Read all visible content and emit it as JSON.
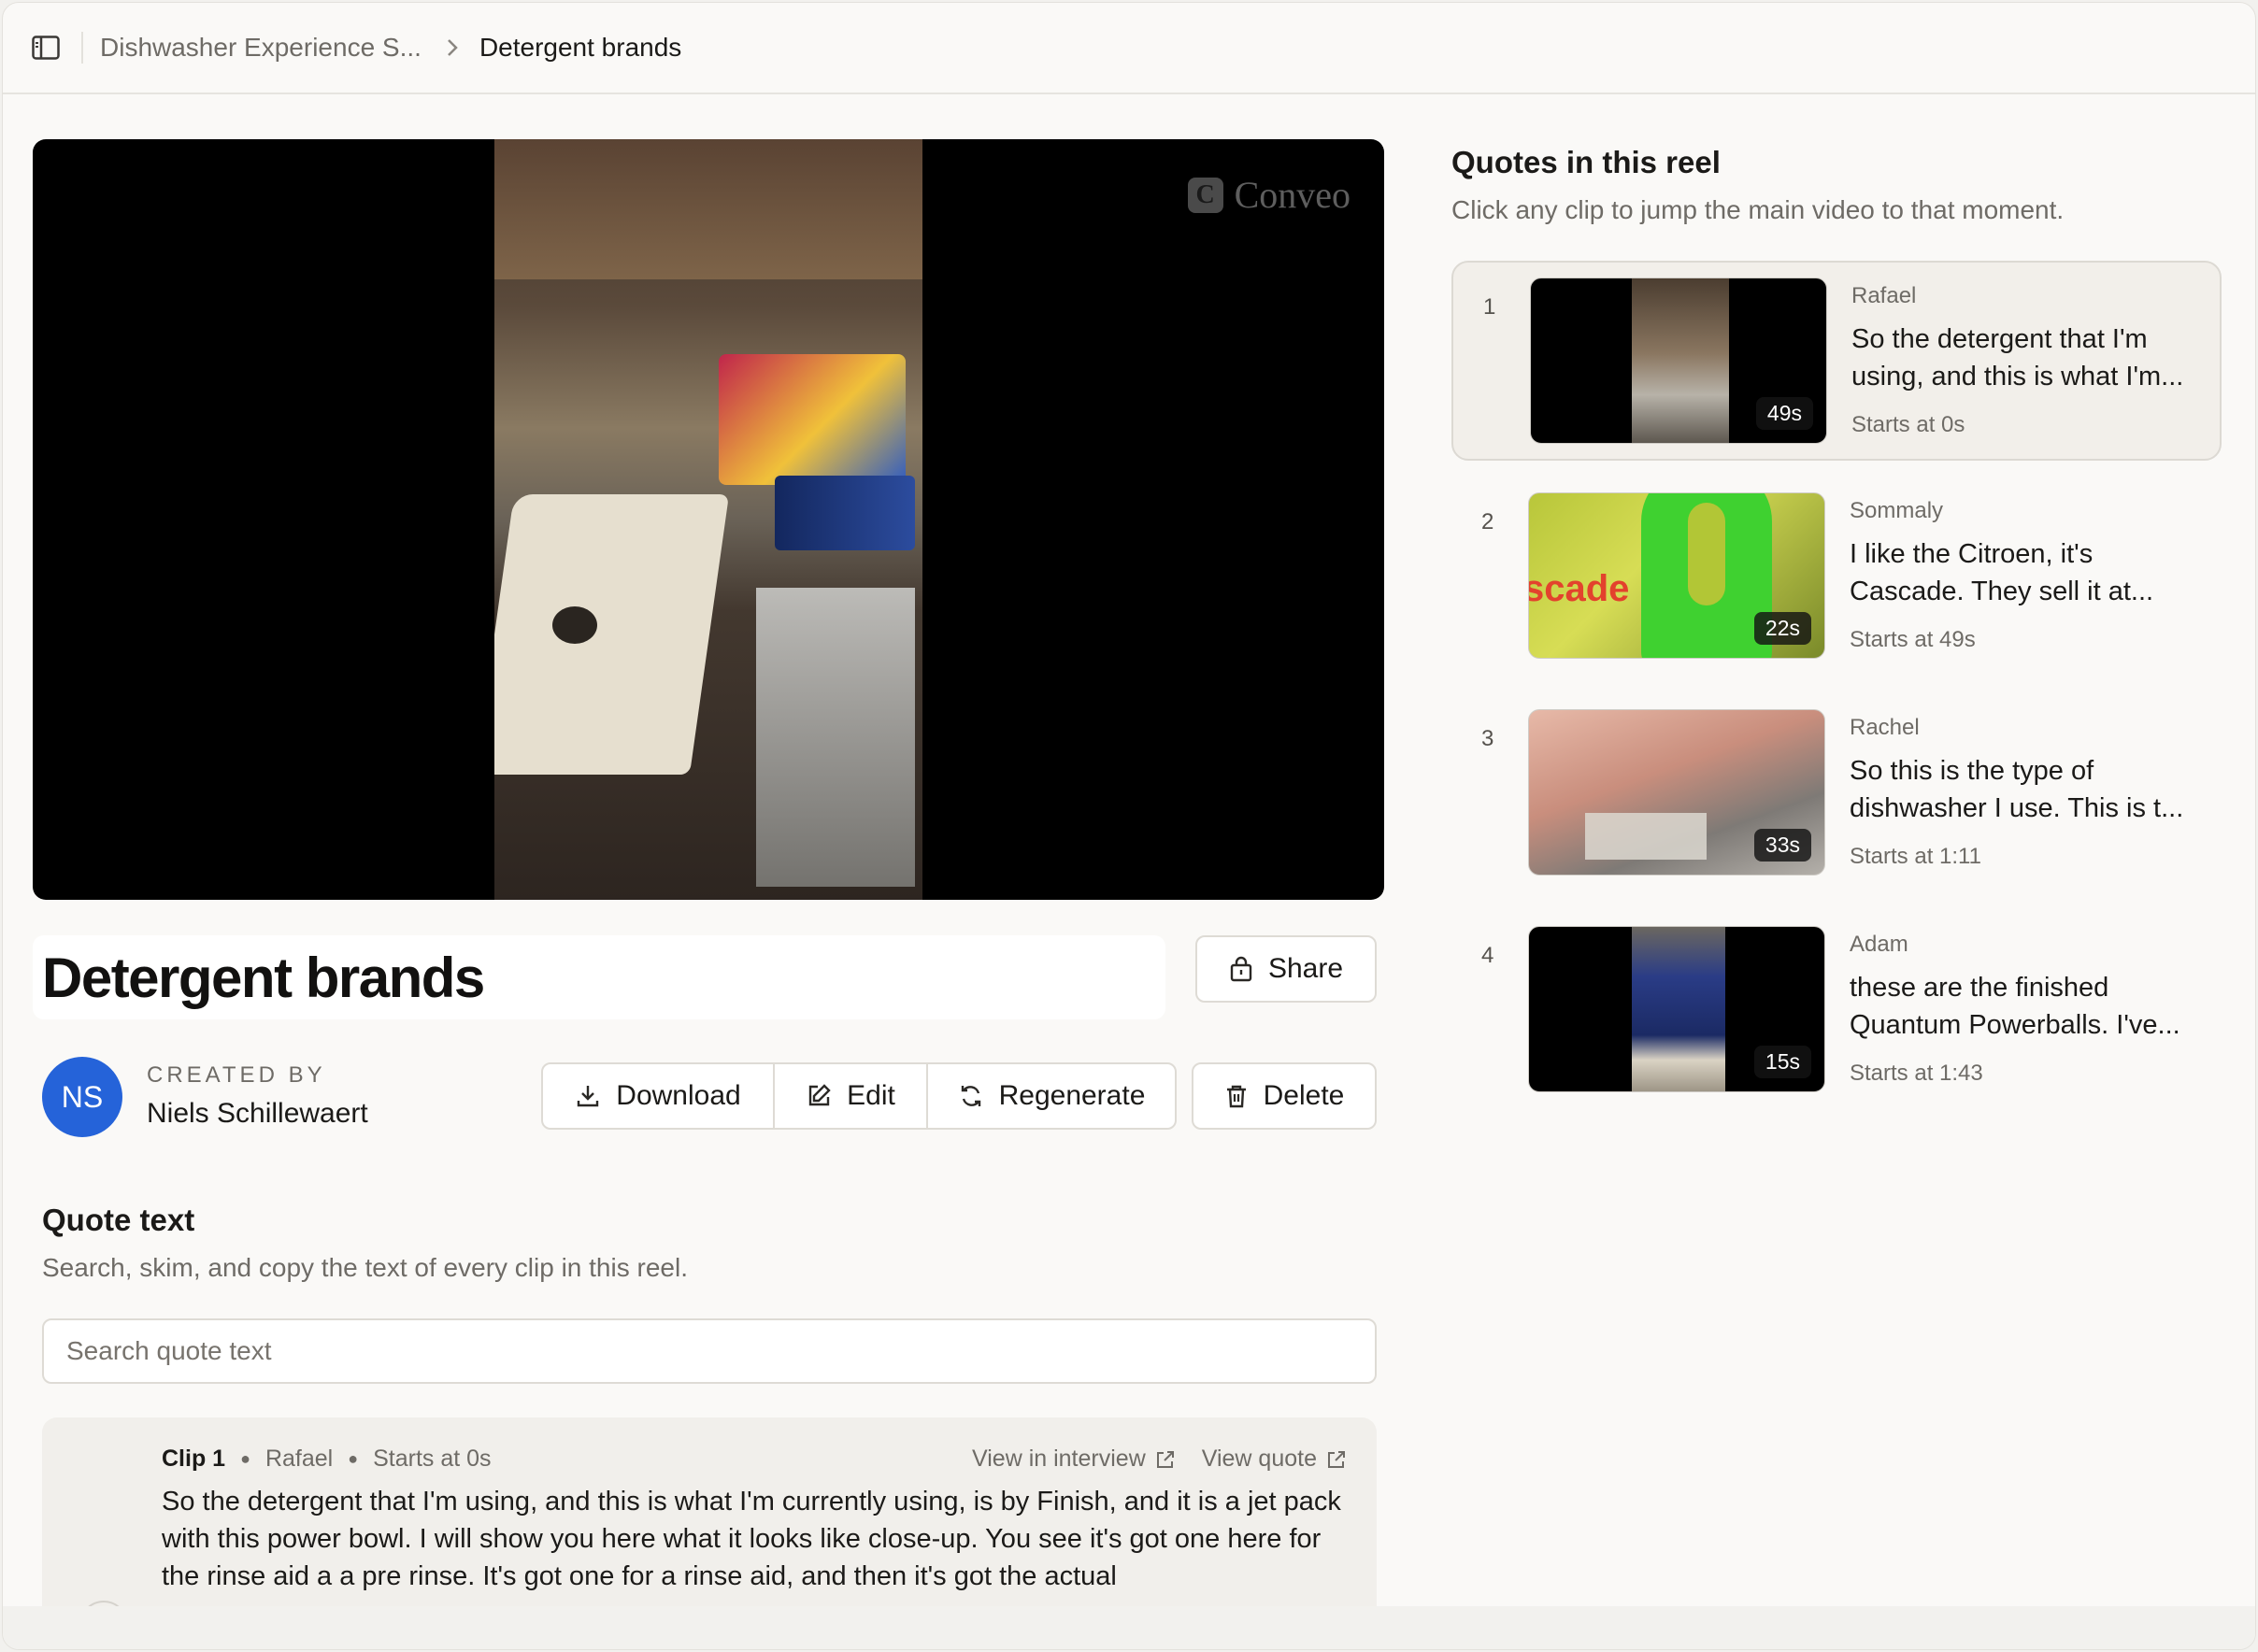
{
  "header": {
    "breadcrumb_parent": "Dishwasher Experience S...",
    "breadcrumb_current": "Detergent brands"
  },
  "video": {
    "watermark": "Conveo",
    "watermark_badge": "C"
  },
  "reel": {
    "title": "Detergent brands",
    "share_label": "Share",
    "created_by_label": "CREATED BY",
    "creator_initials": "NS",
    "creator_name": "Niels Schillewaert",
    "actions": {
      "download": "Download",
      "edit": "Edit",
      "regenerate": "Regenerate",
      "delete": "Delete"
    },
    "accent_color": "#2563d9"
  },
  "quote_text": {
    "heading": "Quote text",
    "subtitle": "Search, skim, and copy the text of every clip in this reel.",
    "search_placeholder": "Search quote text",
    "clips": [
      {
        "clip_label": "Clip 1",
        "speaker": "Rafael",
        "starts": "Starts at 0s",
        "view_interview": "View in interview",
        "view_quote": "View quote",
        "text": "So the detergent that I'm using, and this is what I'm currently using, is by Finish, and it is a jet pack with this power bowl. I will show you here what it looks like close-up. You see it's got one here for the rinse aid a a pre rinse. It's got one for a rinse aid, and then it's got the actual"
      }
    ]
  },
  "quotes_panel": {
    "title": "Quotes in this reel",
    "subtitle": "Click any clip to jump the main video to that moment.",
    "items": [
      {
        "num": "1",
        "speaker": "Rafael",
        "line1": "So the detergent that I'm",
        "line2": "using, and this is what I'm...",
        "starts": "Starts at 0s",
        "duration": "49s"
      },
      {
        "num": "2",
        "speaker": "Sommaly",
        "line1": "I like the Citroen, it's",
        "line2": "Cascade. They sell it at...",
        "starts": "Starts at 49s",
        "duration": "22s"
      },
      {
        "num": "3",
        "speaker": "Rachel",
        "line1": "So this is the type of",
        "line2": "dishwasher I use. This is t...",
        "starts": "Starts at 1:11",
        "duration": "33s"
      },
      {
        "num": "4",
        "speaker": "Adam",
        "line1": "these are the finished",
        "line2": "Quantum Powerballs. I've...",
        "starts": "Starts at 1:43",
        "duration": "15s"
      }
    ]
  }
}
